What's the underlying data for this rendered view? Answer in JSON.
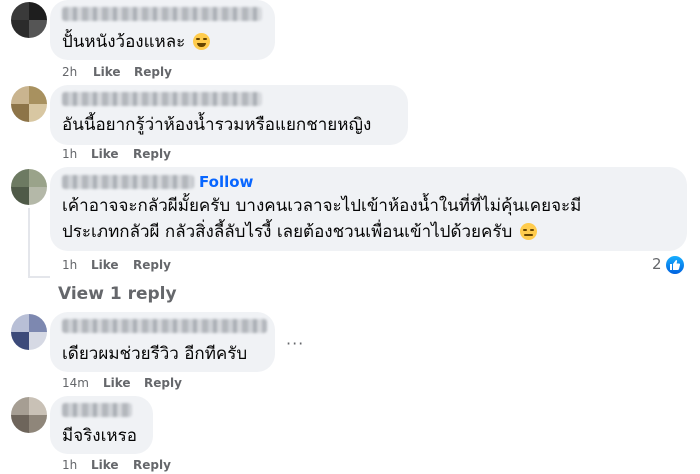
{
  "comments": [
    {
      "text": "ปั้นหนังว้องแหละ",
      "emoji": "grinning-sweat-emoji",
      "time": "2h",
      "like": "Like",
      "reply": "Reply"
    },
    {
      "text": "อันนี้อยากรู้ว่าห้องน้ำรวมหรือแยกชายหญิง",
      "time": "1h",
      "like": "Like",
      "reply": "Reply"
    },
    {
      "follow": "Follow",
      "line1": "เค้าอาจจะกลัวผีมั้ยครับ บางคนเวลาจะไปเข้าห้องน้ำในที่ที่ไม่คุ้นเคยจะมี",
      "line2": "ประเภทกลัวผี กลัวสิ่งลี้ลับไรงี้ เลยต้องชวนเพื่อนเข้าไปด้วยครับ",
      "emoji": "disappointed-relieved-emoji",
      "time": "1h",
      "like": "Like",
      "reply": "Reply",
      "reaction_count": "2"
    },
    {
      "text": "เดียวผมช่วยรีวิว อีกทีครับ",
      "time": "14m",
      "like": "Like",
      "reply": "Reply",
      "more": "···"
    },
    {
      "text": "มีจริงเหรอ",
      "time": "1h",
      "like": "Like",
      "reply": "Reply"
    }
  ],
  "view_replies": "View 1 reply",
  "colors": {
    "bubble": "#f0f2f5",
    "meta": "#65676b",
    "follow": "#0866ff",
    "text": "#050505"
  }
}
